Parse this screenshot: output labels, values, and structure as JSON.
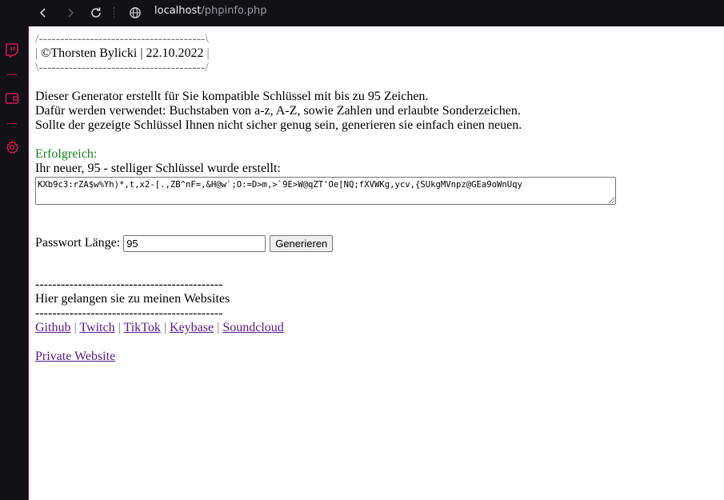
{
  "browser": {
    "url_host": "localhost",
    "url_path": "/phpinfo.php"
  },
  "sidebar": {
    "accent_color": "#b0163f",
    "items": [
      {
        "icon": "twitch-icon"
      },
      {
        "icon": "wallet-icon"
      },
      {
        "icon": "gear-icon"
      }
    ]
  },
  "header_box": {
    "top": "/---------------------------------------\\",
    "bar": "|",
    "text": " ©Thorsten Bylicki | 22.10.2022 ",
    "bottom": "\\---------------------------------------/"
  },
  "intro": {
    "line1": "Dieser Generator erstellt für Sie kompatible Schlüssel mit bis zu 95 Zeichen.",
    "line2": "Dafür werden verwendet: Buchstaben von a-z, A-Z, sowie Zahlen und erlaubte Sonderzeichen.",
    "line3": "Sollte der gezeigte Schlüssel Ihnen nicht sicher genug sein, generieren sie einfach einen neuen."
  },
  "result": {
    "status": "Erfolgreich:",
    "status_color": "#158415",
    "message": "Ihr neuer, 95 - stelliger Schlüssel wurde erstellt:",
    "key": "KXb9c3:rZA$w%Yh)*,t,x2-[.,ZB^nF=,&H@w`;O:=D>m,>`9E>W@qZT'Oe[NQ;fXVWKg,ycv,{SUkgMVnpz@GEa9oWnUqy"
  },
  "form": {
    "length_label": "Passwort Länge:",
    "length_value": "95",
    "generate_label": "Generieren"
  },
  "links_section": {
    "dashes": "--------------------------------------------",
    "heading": "Hier gelangen sie zu meinen Websites",
    "separator": "|",
    "links": [
      "Github",
      "Twitch",
      "TikTok",
      "Keybase",
      "Soundcloud"
    ],
    "private": "Private Website"
  }
}
